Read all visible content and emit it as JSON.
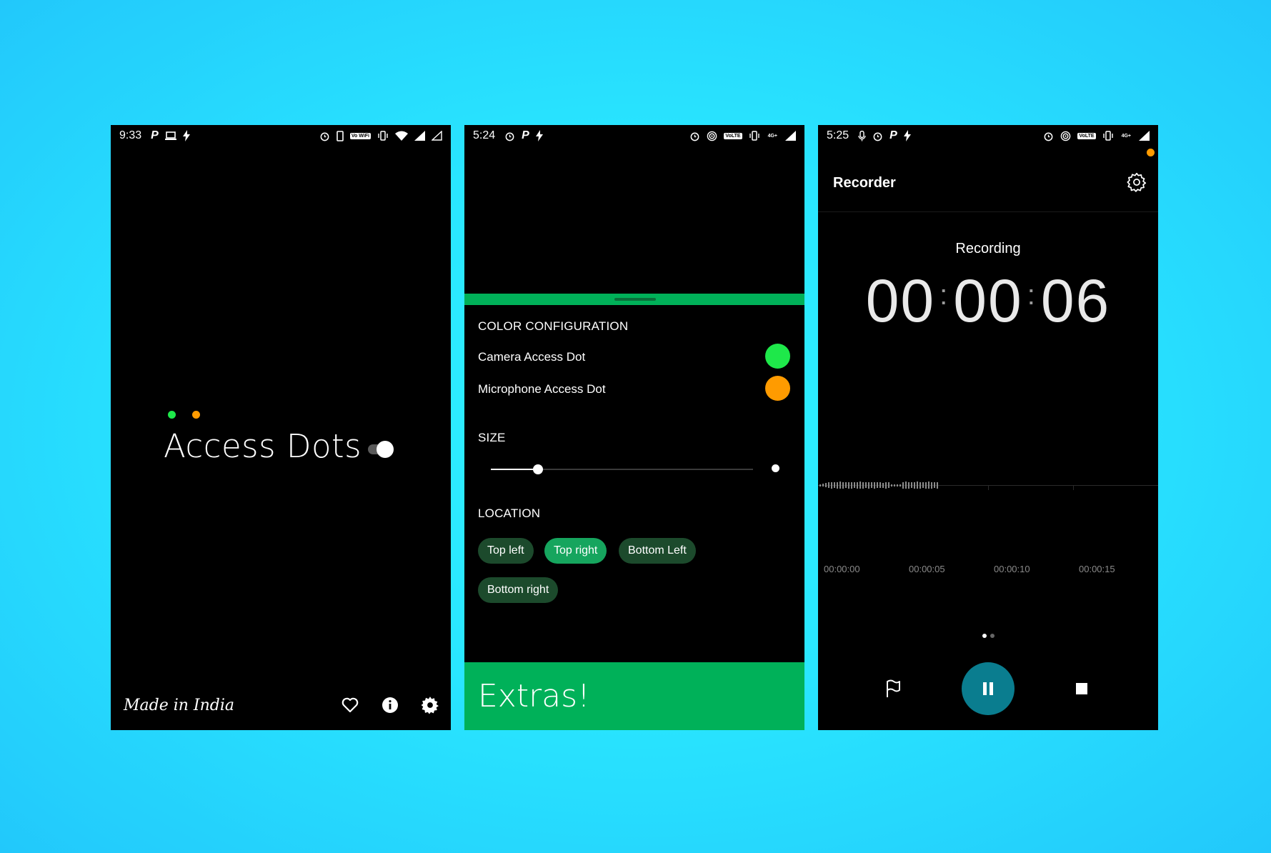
{
  "background_color": "#29e6ff",
  "phone1": {
    "status": {
      "time": "9:33",
      "wifi_tag": "Vo WiFi"
    },
    "dot_colors": {
      "camera": "#1ee84a",
      "microphone": "#ff9b00"
    },
    "title": "Access Dots",
    "toggle_on": true,
    "footer_text": "Made in India",
    "footer_icons": [
      "heart-icon",
      "info-icon",
      "gear-icon"
    ]
  },
  "phone2": {
    "status": {
      "time": "5:24",
      "lte_tag": "VoLTE",
      "net_tag": "4G+"
    },
    "accent": "#00b159",
    "color_section": "COLOR CONFIGURATION",
    "camera_row": "Camera Access Dot",
    "microphone_row": "Microphone Access Dot",
    "camera_color": "#1ee84a",
    "microphone_color": "#ff9b00",
    "size_section": "SIZE",
    "size_value": 0.18,
    "location_section": "LOCATION",
    "locations": [
      "Top left",
      "Top right",
      "Bottom Left",
      "Bottom right"
    ],
    "selected_location": "Top right",
    "extras": "Extras!"
  },
  "phone3": {
    "status": {
      "time": "5:25",
      "lte_tag": "VoLTE",
      "net_tag": "4G+"
    },
    "app_title": "Recorder",
    "status_label": "Recording",
    "timer": {
      "hours": "00",
      "minutes": "00",
      "seconds": "06"
    },
    "timeline": [
      "00:00:00",
      "00:00:05",
      "00:00:10",
      "00:00:15"
    ],
    "page_index": 1,
    "page_count": 2,
    "accent": "#0a7d8f"
  }
}
